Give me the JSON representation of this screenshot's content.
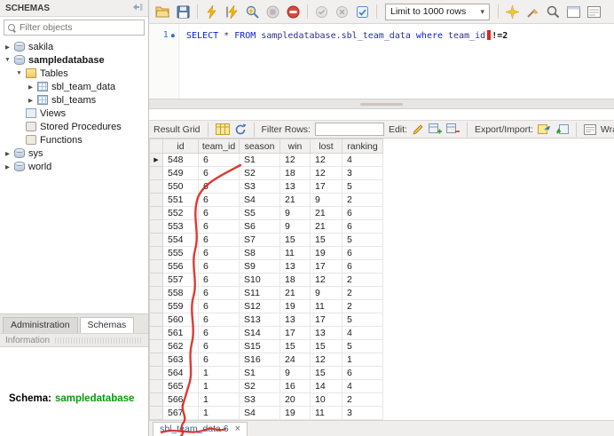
{
  "sidebar": {
    "title": "SCHEMAS",
    "filter_placeholder": "Filter objects",
    "tree": [
      {
        "label": "sakila",
        "icon": "schema-icon",
        "expand": "right",
        "indent": 0,
        "bold": false
      },
      {
        "label": "sampledatabase",
        "icon": "schema-icon",
        "expand": "down",
        "indent": 0,
        "bold": true
      },
      {
        "label": "Tables",
        "icon": "tables-folder-icon",
        "expand": "down",
        "indent": 1,
        "bold": false
      },
      {
        "label": "sbl_team_data",
        "icon": "table-icon",
        "expand": "right",
        "indent": 2,
        "bold": false
      },
      {
        "label": "sbl_teams",
        "icon": "table-icon",
        "expand": "right",
        "indent": 2,
        "bold": false
      },
      {
        "label": "Views",
        "icon": "views-icon",
        "expand": "",
        "indent": 1,
        "bold": false
      },
      {
        "label": "Stored Procedures",
        "icon": "stored-procedures-icon",
        "expand": "",
        "indent": 1,
        "bold": false
      },
      {
        "label": "Functions",
        "icon": "functions-icon",
        "expand": "",
        "indent": 1,
        "bold": false
      },
      {
        "label": "sys",
        "icon": "schema-icon",
        "expand": "right",
        "indent": 0,
        "bold": false
      },
      {
        "label": "world",
        "icon": "schema-icon",
        "expand": "right",
        "indent": 0,
        "bold": false
      }
    ],
    "tabs": [
      {
        "label": "Administration",
        "active": false
      },
      {
        "label": "Schemas",
        "active": true
      }
    ],
    "info_title": "Information",
    "schema_label": "Schema:",
    "schema_name": "sampledatabase"
  },
  "toolbar": {
    "limit_label": "Limit to 1000 rows"
  },
  "editor": {
    "line_number": "1",
    "sql": {
      "select": "SELECT",
      "star": " * ",
      "from": "FROM",
      "table": " sampledatabase.sbl_team_data ",
      "where": "where",
      "field": " team_id",
      "operator": "!=2"
    }
  },
  "result_toolbar": {
    "grid_label": "Result Grid",
    "filter_label": "Filter Rows:",
    "filter_value": "",
    "edit_label": "Edit:",
    "export_label": "Export/Import:",
    "wrap_label": "Wrap Cell Co"
  },
  "grid": {
    "columns": [
      "id",
      "team_id",
      "season",
      "win",
      "lost",
      "ranking"
    ],
    "rows": [
      [
        548,
        6,
        "S1",
        12,
        12,
        4
      ],
      [
        549,
        6,
        "S2",
        18,
        12,
        3
      ],
      [
        550,
        6,
        "S3",
        13,
        17,
        5
      ],
      [
        551,
        6,
        "S4",
        21,
        9,
        2
      ],
      [
        552,
        6,
        "S5",
        9,
        21,
        6
      ],
      [
        553,
        6,
        "S6",
        9,
        21,
        6
      ],
      [
        554,
        6,
        "S7",
        15,
        15,
        5
      ],
      [
        555,
        6,
        "S8",
        11,
        19,
        6
      ],
      [
        556,
        6,
        "S9",
        13,
        17,
        6
      ],
      [
        557,
        6,
        "S10",
        18,
        12,
        2
      ],
      [
        558,
        6,
        "S11",
        21,
        9,
        2
      ],
      [
        559,
        6,
        "S12",
        19,
        11,
        2
      ],
      [
        560,
        6,
        "S13",
        13,
        17,
        5
      ],
      [
        561,
        6,
        "S14",
        17,
        13,
        4
      ],
      [
        562,
        6,
        "S15",
        15,
        15,
        5
      ],
      [
        563,
        6,
        "S16",
        24,
        12,
        1
      ],
      [
        564,
        1,
        "S1",
        9,
        15,
        6
      ],
      [
        565,
        1,
        "S2",
        16,
        14,
        4
      ],
      [
        566,
        1,
        "S3",
        20,
        10,
        2
      ],
      [
        567,
        1,
        "S4",
        19,
        11,
        3
      ]
    ]
  },
  "bottom_tab": {
    "label": "sbl_team_data 6",
    "close": "×"
  },
  "icons": {
    "expand": "▶",
    "collapse": "▼",
    "row_marker": "▶",
    "dropdown_arrow": "▾",
    "statement_dot": "●",
    "pilcrow": "¶"
  }
}
